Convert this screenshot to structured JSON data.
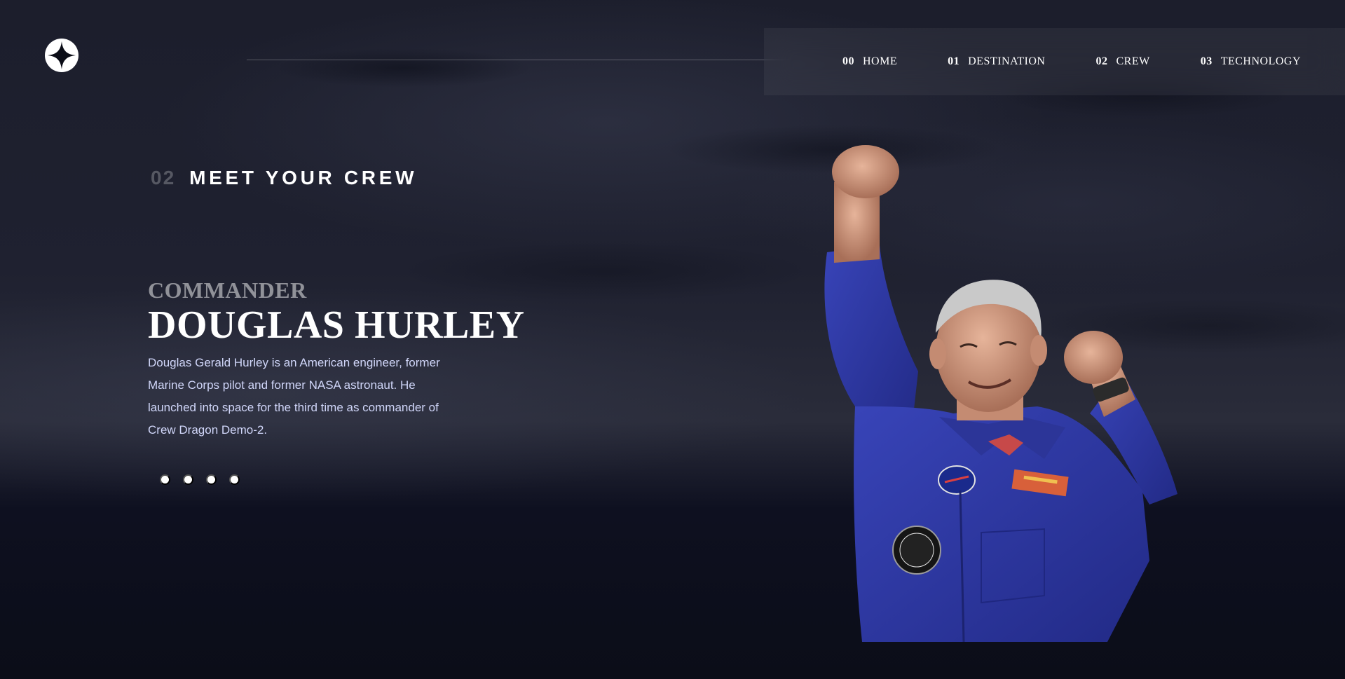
{
  "nav": {
    "items": [
      {
        "num": "00",
        "label": "HOME"
      },
      {
        "num": "01",
        "label": "DESTINATION"
      },
      {
        "num": "02",
        "label": "CREW"
      },
      {
        "num": "03",
        "label": "TECHNOLOGY"
      }
    ]
  },
  "page": {
    "eyebrow_num": "02",
    "eyebrow_label": "MEET YOUR CREW"
  },
  "crew": {
    "role": "Commander",
    "name": "Douglas Hurley",
    "bio": "Douglas Gerald Hurley is an American engineer, former Marine Corps pilot and former NASA astronaut. He launched into space for the third time as commander of Crew Dragon Demo-2.",
    "pagination_count": 4,
    "active_index": 0
  },
  "colors": {
    "background": "#0c0e1a",
    "text": "#ffffff",
    "body_text": "#d0d6f9",
    "suit_blue": "#2e3aa8"
  },
  "icons": {
    "logo": "four-point-star-logo-icon"
  }
}
